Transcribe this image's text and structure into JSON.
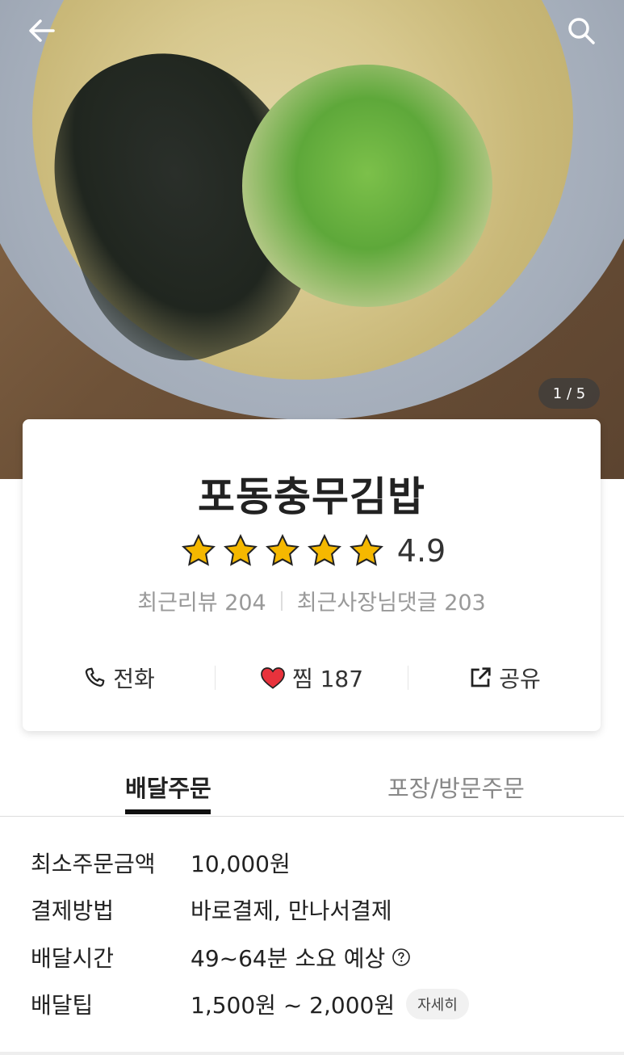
{
  "hero": {
    "page_counter": "1 / 5",
    "back_icon": "arrow-left-icon",
    "search_icon": "search-icon"
  },
  "store": {
    "name": "포동충무김밥",
    "rating": 4.9,
    "rating_text": "4.9",
    "stars": 5,
    "recent_reviews": "최근리뷰 204",
    "owner_replies": "최근사장님댓글 203"
  },
  "actions": {
    "call": "전화",
    "favorite": "찜 187",
    "share": "공유"
  },
  "tabs": {
    "delivery": "배달주문",
    "pickup": "포장/방문주문"
  },
  "details": {
    "min_order_label": "최소주문금액",
    "min_order_value": "10,000원",
    "payment_label": "결제방법",
    "payment_value": "바로결제, 만나서결제",
    "time_label": "배달시간",
    "time_value": "49~64분 소요 예상",
    "tip_label": "배달팁",
    "tip_value": "1,500원 ~ 2,000원",
    "tip_detail_button": "자세히"
  },
  "colors": {
    "star": "#f5b800",
    "heart": "#e8323c",
    "accent_underline": "#111111"
  }
}
